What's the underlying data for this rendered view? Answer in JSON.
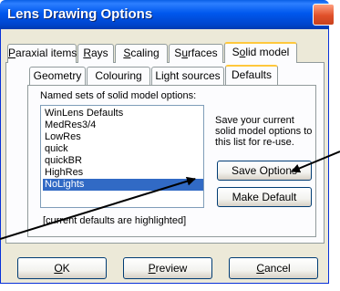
{
  "window": {
    "title": "Lens Drawing Options"
  },
  "outer_tabs": [
    {
      "pre": "",
      "u": "P",
      "post": "araxial items",
      "active": false
    },
    {
      "pre": "",
      "u": "R",
      "post": "ays",
      "active": false
    },
    {
      "pre": "",
      "u": "S",
      "post": "caling",
      "active": false
    },
    {
      "pre": "S",
      "u": "u",
      "post": "rfaces",
      "active": false
    },
    {
      "pre": "S",
      "u": "o",
      "post": "lid model",
      "active": true
    }
  ],
  "inner_tabs": [
    {
      "label": "Geometry",
      "active": false
    },
    {
      "label": "Colouring",
      "active": false
    },
    {
      "label": "Light sources",
      "active": false
    },
    {
      "label": "Defaults",
      "active": true
    }
  ],
  "defaults": {
    "list_label": "Named sets of solid model options:",
    "items": [
      "WinLens Defaults",
      "MedRes3/4",
      "LowRes",
      "quick",
      "quickBR",
      "HighRes",
      "NoLights"
    ],
    "selected": "NoLights",
    "hint": "[current defaults are highlighted]",
    "side_text": "Save your current solid model options to this list for re-use.",
    "save_button": "Save Options",
    "make_default_button": "Make Default"
  },
  "buttons": {
    "ok": {
      "u": "O",
      "post": "K"
    },
    "preview": {
      "u": "P",
      "post": "review"
    },
    "cancel": {
      "u": "C",
      "post": "ancel"
    }
  },
  "colors": {
    "titlebar": "#0058ee",
    "selection": "#316ac5",
    "dialog_face": "#ece9d8",
    "active_tab_accent": "#ffc83c"
  }
}
